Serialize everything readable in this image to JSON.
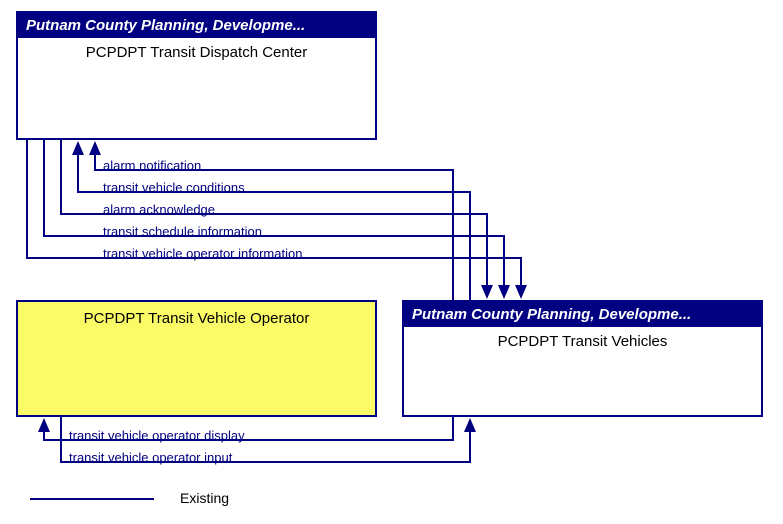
{
  "nodes": {
    "dispatch": {
      "header": "Putnam County Planning, Developme...",
      "body": "PCPDPT Transit Dispatch Center"
    },
    "operator": {
      "body": "PCPDPT Transit Vehicle Operator"
    },
    "vehicles": {
      "header": "Putnam County Planning, Developme...",
      "body": "PCPDPT Transit Vehicles"
    }
  },
  "flows": {
    "f1": "alarm notification",
    "f2": "transit vehicle conditions",
    "f3": "alarm acknowledge",
    "f4": "transit schedule information",
    "f5": "transit vehicle operator information",
    "f6": "transit vehicle operator display",
    "f7": "transit vehicle operator input"
  },
  "legend": {
    "existing": "Existing"
  }
}
